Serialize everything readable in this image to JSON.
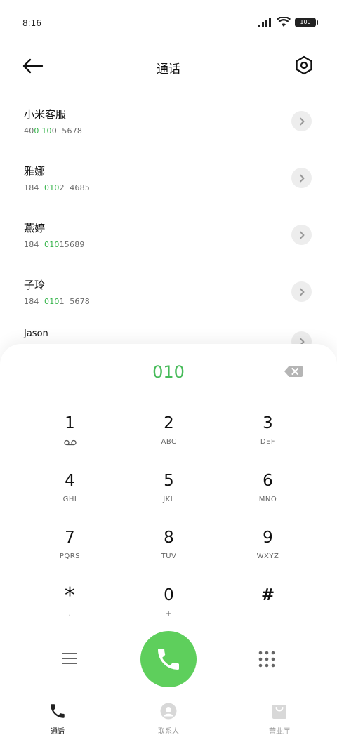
{
  "status": {
    "time": "8:16",
    "battery": "100"
  },
  "header": {
    "title": "通话"
  },
  "contacts": [
    {
      "name": "小米客服",
      "number_parts": [
        {
          "t": "40",
          "hl": false
        },
        {
          "t": "0",
          "hl": true
        },
        {
          "t": " ",
          "hl": false
        },
        {
          "t": "10",
          "hl": true
        },
        {
          "t": "0  5678",
          "hl": false
        }
      ]
    },
    {
      "name": "雅娜",
      "number_parts": [
        {
          "t": "184  ",
          "hl": false
        },
        {
          "t": "010",
          "hl": true
        },
        {
          "t": "2  4685",
          "hl": false
        }
      ]
    },
    {
      "name": "燕婷",
      "number_parts": [
        {
          "t": "184  ",
          "hl": false
        },
        {
          "t": "010",
          "hl": true
        },
        {
          "t": "15689",
          "hl": false
        }
      ]
    },
    {
      "name": "子玲",
      "number_parts": [
        {
          "t": "184  ",
          "hl": false
        },
        {
          "t": "010",
          "hl": true
        },
        {
          "t": "1  5678",
          "hl": false
        }
      ]
    },
    {
      "name": "Jason",
      "number_parts": []
    }
  ],
  "dialer": {
    "number": "010",
    "keys": [
      {
        "digit": "1",
        "letters": "",
        "voicemail": true
      },
      {
        "digit": "2",
        "letters": "ABC"
      },
      {
        "digit": "3",
        "letters": "DEF"
      },
      {
        "digit": "4",
        "letters": "GHI"
      },
      {
        "digit": "5",
        "letters": "JKL"
      },
      {
        "digit": "6",
        "letters": "MNO"
      },
      {
        "digit": "7",
        "letters": "PQRS"
      },
      {
        "digit": "8",
        "letters": "TUV"
      },
      {
        "digit": "9",
        "letters": "WXYZ"
      },
      {
        "digit": "*",
        "letters": ","
      },
      {
        "digit": "0",
        "letters": "+"
      },
      {
        "digit": "#",
        "letters": ""
      }
    ]
  },
  "nav": {
    "calls": "通话",
    "contacts": "联系人",
    "store": "营业厅"
  },
  "colors": {
    "accent": "#47bb5a",
    "call_button": "#5ecf5c"
  }
}
